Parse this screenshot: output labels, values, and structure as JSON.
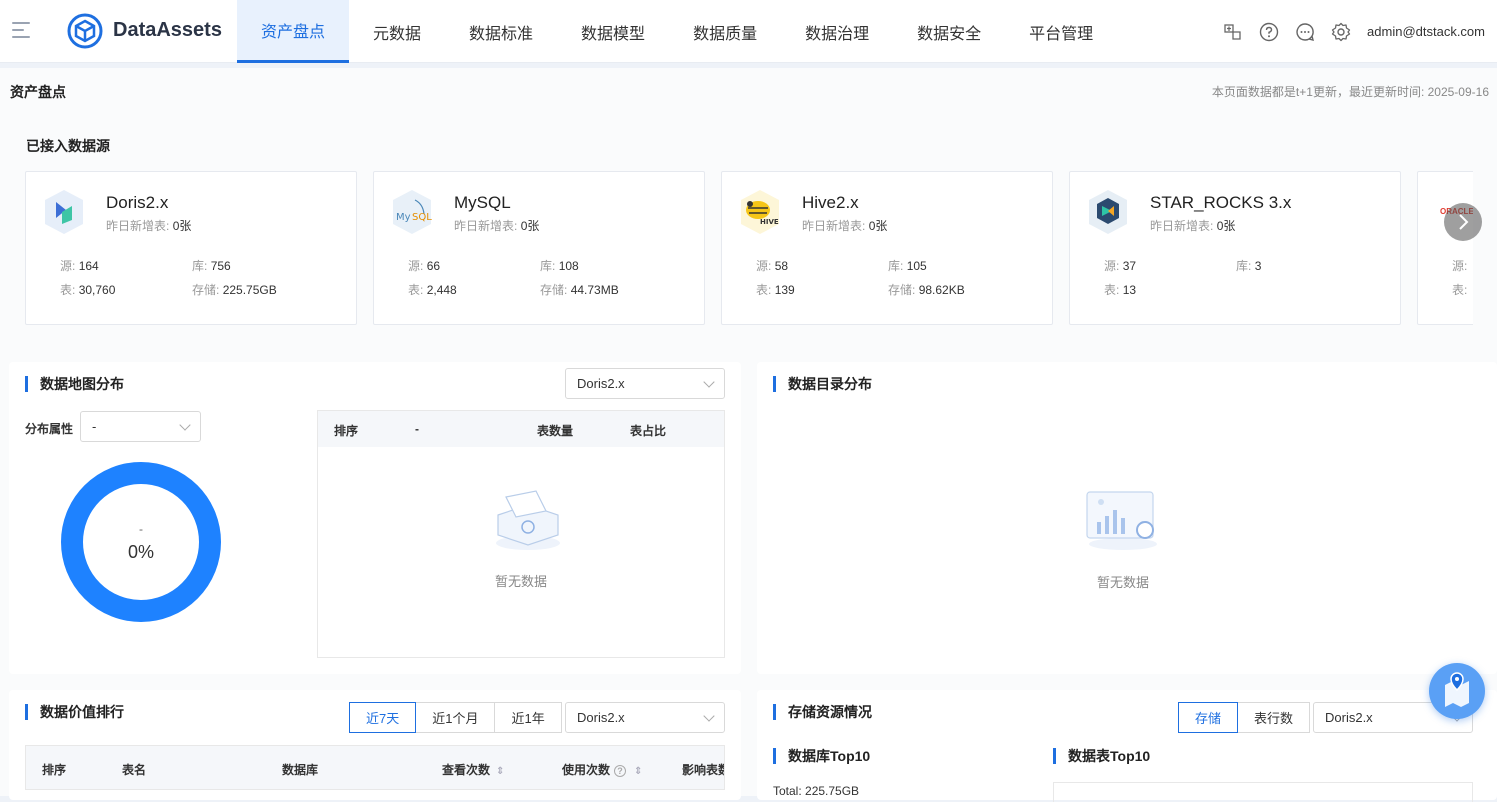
{
  "app": {
    "brand": "DataAssets",
    "user": "admin@dtstack.com"
  },
  "nav": [
    {
      "label": "资产盘点",
      "active": true
    },
    {
      "label": "元数据"
    },
    {
      "label": "数据标准"
    },
    {
      "label": "数据模型"
    },
    {
      "label": "数据质量"
    },
    {
      "label": "数据治理"
    },
    {
      "label": "数据安全"
    },
    {
      "label": "平台管理"
    }
  ],
  "page": {
    "title": "资产盘点",
    "update_note": "本页面数据都是t+1更新，最近更新时间: 2025-09-16"
  },
  "sources": {
    "title": "已接入数据源",
    "cards": [
      {
        "name": "Doris2.x",
        "inc_label": "昨日新增表:",
        "inc": "0张",
        "src_label": "源:",
        "src": "164",
        "db_label": "库:",
        "db": "756",
        "tbl_label": "表:",
        "tbl": "30,760",
        "store_label": "存储:",
        "store": "225.75GB"
      },
      {
        "name": "MySQL",
        "inc_label": "昨日新增表:",
        "inc": "0张",
        "src_label": "源:",
        "src": "66",
        "db_label": "库:",
        "db": "108",
        "tbl_label": "表:",
        "tbl": "2,448",
        "store_label": "存储:",
        "store": "44.73MB"
      },
      {
        "name": "Hive2.x",
        "inc_label": "昨日新增表:",
        "inc": "0张",
        "src_label": "源:",
        "src": "58",
        "db_label": "库:",
        "db": "105",
        "tbl_label": "表:",
        "tbl": "139",
        "store_label": "存储:",
        "store": "98.62KB"
      },
      {
        "name": "STAR_ROCKS 3.x",
        "inc_label": "昨日新增表:",
        "inc": "0张",
        "src_label": "源:",
        "src": "37",
        "db_label": "库:",
        "db": "3",
        "tbl_label": "表:",
        "tbl": "13",
        "store_label": "",
        "store": ""
      },
      {
        "name": "",
        "logo_text": "ORACLE",
        "inc_label": "",
        "inc": "",
        "src_label": "源:",
        "src": "",
        "db_label": "",
        "db": "",
        "tbl_label": "表:",
        "tbl": "",
        "store_label": "",
        "store": ""
      }
    ]
  },
  "map_panel": {
    "title": "数据地图分布",
    "source_select": "Doris2.x",
    "attr_label": "分布属性",
    "attr_select": "-",
    "donut_label": "-",
    "donut_value": "0%",
    "columns": [
      "排序",
      "-",
      "表数量",
      "表占比"
    ],
    "empty": "暂无数据"
  },
  "catalog_panel": {
    "title": "数据目录分布",
    "empty": "暂无数据"
  },
  "rank_panel": {
    "title": "数据价值排行",
    "ranges": [
      "近7天",
      "近1个月",
      "近1年"
    ],
    "source_select": "Doris2.x",
    "columns": [
      "排序",
      "表名",
      "数据库",
      "查看次数",
      "使用次数",
      "影响表数"
    ]
  },
  "storage_panel": {
    "title": "存储资源情况",
    "toggles": [
      "存储",
      "表行数"
    ],
    "source_select": "Doris2.x",
    "db_top": "数据库Top10",
    "tbl_top": "数据表Top10",
    "total": "Total: 225.75GB"
  },
  "colors": {
    "accent": "#1e6fe0",
    "donut": "#1e82ff"
  }
}
